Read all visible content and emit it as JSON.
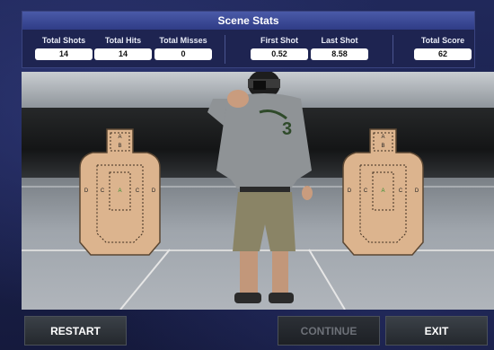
{
  "stats": {
    "title": "Scene Stats",
    "items": [
      {
        "label": "Total Shots",
        "value": "14"
      },
      {
        "label": "Total Hits",
        "value": "14"
      },
      {
        "label": "Total Misses",
        "value": "0"
      },
      {
        "label": "First Shot",
        "value": "0.52"
      },
      {
        "label": "Last Shot",
        "value": "8.58"
      },
      {
        "label": "Total Score",
        "value": "62"
      }
    ]
  },
  "targets": {
    "left": {
      "top": "A",
      "mid": "B",
      "center": "A",
      "left1": "D",
      "left2": "C",
      "right1": "C",
      "right2": "D"
    },
    "right": {
      "top": "A",
      "mid": "B",
      "center": "A",
      "left1": "D",
      "left2": "C",
      "right1": "C",
      "right2": "D"
    }
  },
  "shooter": {
    "shirt_number": "3"
  },
  "buttons": {
    "restart": "RESTART",
    "continue": "CONTINUE",
    "exit": "EXIT"
  },
  "colors": {
    "panel_header": "#3a4a9a",
    "target_fill": "#dcb48e",
    "button_disabled_text": "#6d7178"
  }
}
